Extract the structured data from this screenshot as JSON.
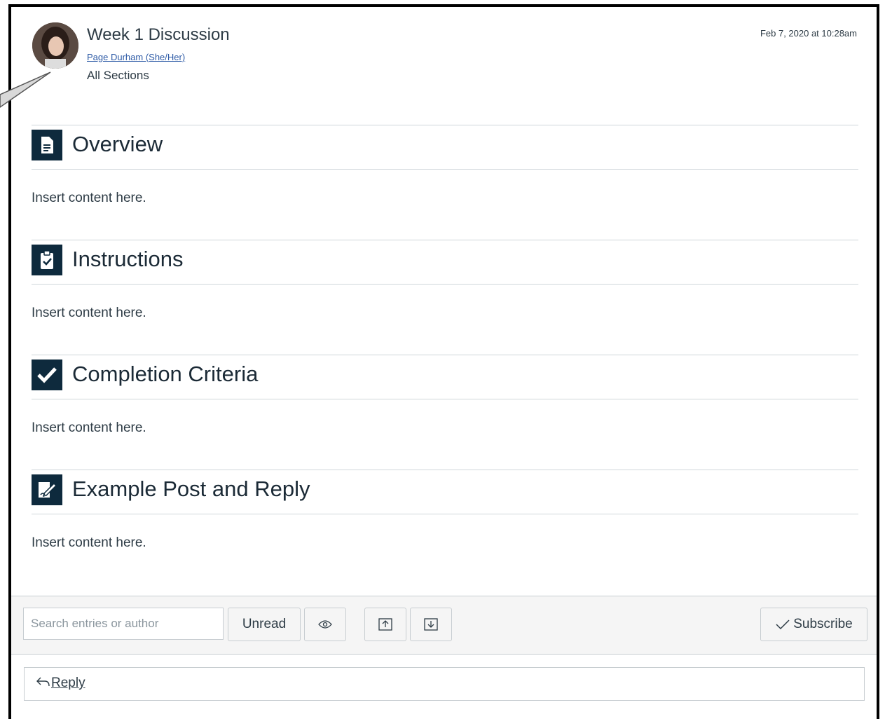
{
  "post": {
    "title": "Week 1 Discussion",
    "author": "Page Durham (She/Her)",
    "sections_label": "All Sections",
    "date": "Feb 7, 2020 at 10:28am"
  },
  "sections": [
    {
      "heading": "Overview",
      "icon": "document-icon",
      "body": "Insert content here."
    },
    {
      "heading": "Instructions",
      "icon": "clipboard-check-icon",
      "body": "Insert content here."
    },
    {
      "heading": "Completion Criteria",
      "icon": "checkmark-icon",
      "body": "Insert content here."
    },
    {
      "heading": "Example Post and Reply",
      "icon": "edit-document-icon",
      "body": "Insert content here."
    }
  ],
  "toolbar": {
    "search_placeholder": "Search entries or author",
    "unread_label": "Unread",
    "subscribe_label": "Subscribe"
  },
  "reply": {
    "label": "Reply"
  },
  "colors": {
    "icon_bg": "#0e2a3d",
    "link": "#2d5aa6",
    "text": "#2d3b45"
  }
}
